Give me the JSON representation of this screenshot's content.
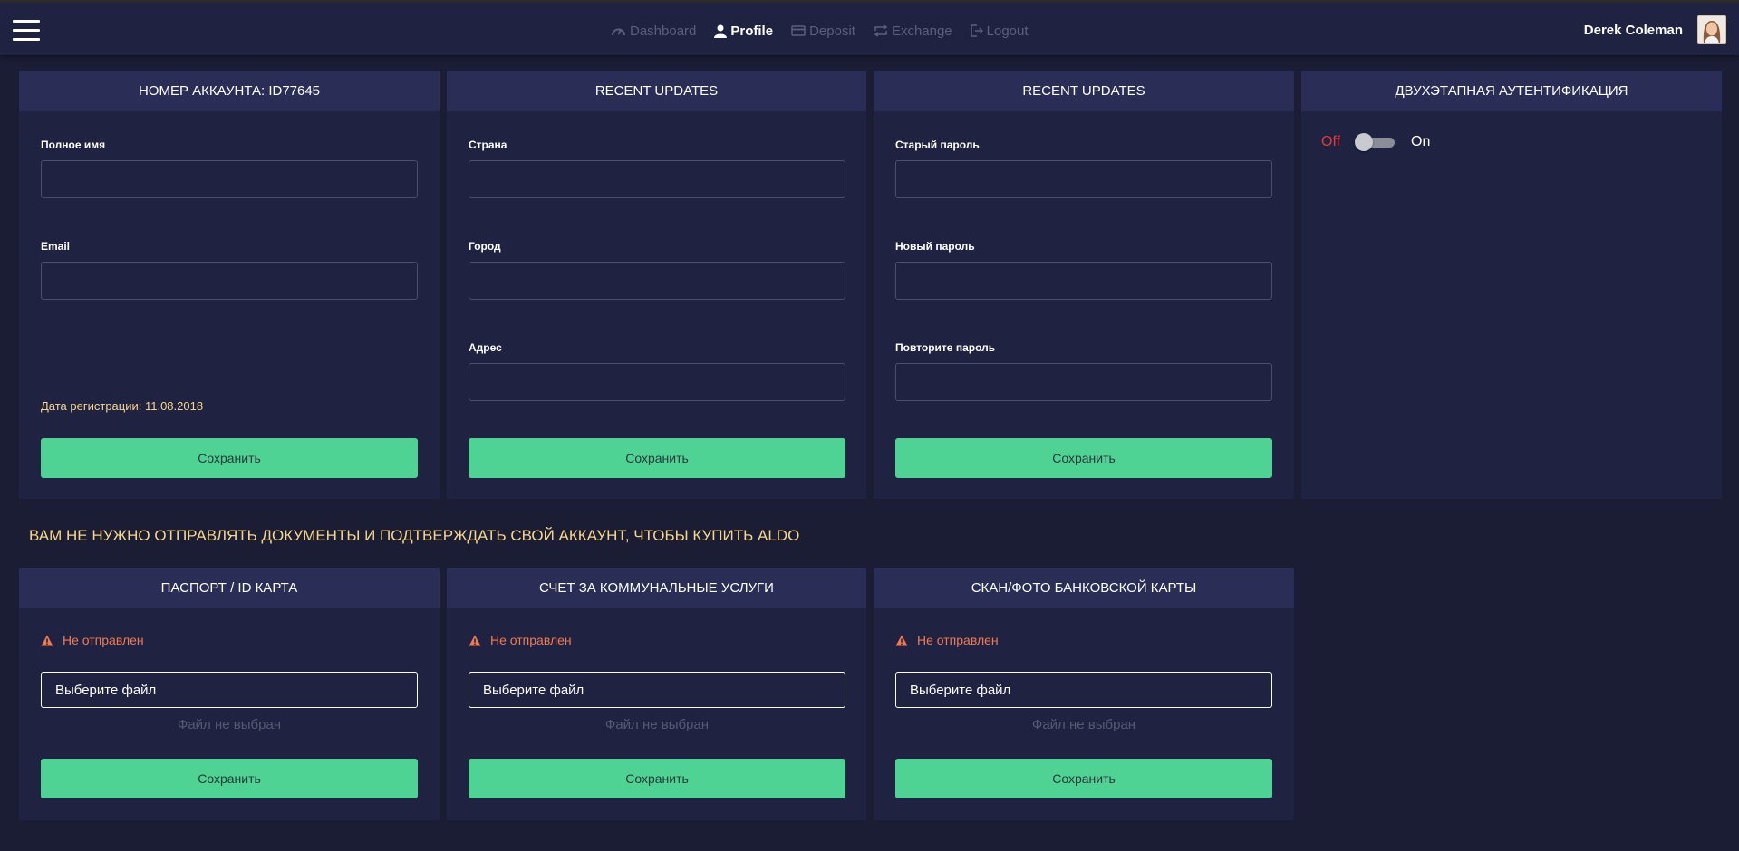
{
  "nav": {
    "items": [
      {
        "label": "Dashboard",
        "icon": "gauge-icon",
        "active": false
      },
      {
        "label": "Profile",
        "icon": "user-icon",
        "active": true
      },
      {
        "label": "Deposit",
        "icon": "card-icon",
        "active": false
      },
      {
        "label": "Exchange",
        "icon": "exchange-icon",
        "active": false
      },
      {
        "label": "Logout",
        "icon": "logout-icon",
        "active": false
      }
    ],
    "user_name": "Derek Coleman"
  },
  "account": {
    "title": "НОМЕР АККАУНТА: ID77645",
    "full_name_label": "Полное имя",
    "full_name_value": "",
    "email_label": "Email",
    "email_value": "",
    "reg_date": "Дата регистрации: 11.08.2018",
    "save_label": "Сохранить"
  },
  "location": {
    "title": "RECENT UPDATES",
    "country_label": "Страна",
    "city_label": "Город",
    "address_label": "Адрес",
    "save_label": "Сохранить"
  },
  "password": {
    "title": "RECENT UPDATES",
    "old_label": "Старый пароль",
    "new_label": "Новый пароль",
    "repeat_label": "Повторите пароль",
    "save_label": "Сохранить"
  },
  "twofa": {
    "title": "ДВУХЭТАПНАЯ АУТЕНТИФИКАЦИЯ",
    "off_label": "Off",
    "on_label": "On",
    "enabled": false
  },
  "notice": "ВАМ НЕ НУЖНО ОТПРАВЛЯТЬ ДОКУМЕНТЫ И ПОДТВЕРЖДАТЬ СВОЙ АККАУНТ, ЧТОБЫ КУПИТЬ ALDO",
  "documents": [
    {
      "title": "ПАСПОРТ / ID КАРТА",
      "status": "Не отправлен",
      "file_button": "Выберите файл",
      "file_status": "Файл не выбран",
      "save_label": "Сохранить"
    },
    {
      "title": "СЧЕТ ЗА КОММУНАЛЬНЫЕ УСЛУГИ",
      "status": "Не отправлен",
      "file_button": "Выберите файл",
      "file_status": "Файл не выбран",
      "save_label": "Сохранить"
    },
    {
      "title": "СКАН/ФОТО БАНКОВСКОЙ КАРТЫ",
      "status": "Не отправлен",
      "file_button": "Выберите файл",
      "file_status": "Файл не выбран",
      "save_label": "Сохранить"
    }
  ],
  "colors": {
    "background": "#1a1d33",
    "card": "#1f2341",
    "card_header": "#2a2e57",
    "accent_green": "#4fd394",
    "warning": "#f27a51",
    "gold": "#f6d78a",
    "off_red": "#e23b3b"
  }
}
